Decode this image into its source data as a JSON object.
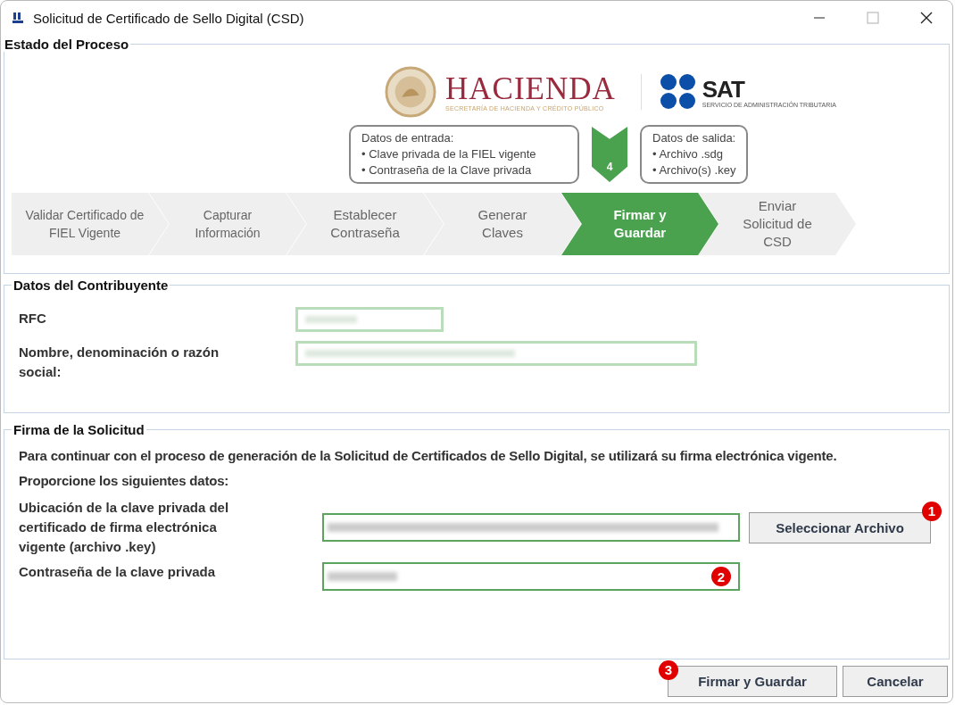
{
  "window": {
    "title": "Solicitud de Certificado de Sello Digital (CSD)"
  },
  "process": {
    "legend": "Estado del Proceso",
    "logo": {
      "brand": "HACIENDA",
      "subtitle": "SECRETARÍA DE HACIENDA Y CRÉDITO PÚBLICO",
      "agency": "SAT",
      "agency_subtitle": "SERVICIO DE ADMINISTRACIÓN TRIBUTARIA"
    },
    "input_box": {
      "title": "Datos de entrada:",
      "items": [
        "• Clave privada de la FIEL vigente",
        "• Contraseña de la Clave privada"
      ]
    },
    "step_marker": "4",
    "output_box": {
      "title": "Datos de salida:",
      "items": [
        "• Archivo .sdg",
        "• Archivo(s) .key"
      ]
    },
    "steps": [
      {
        "label": "Validar Certificado de FIEL Vigente",
        "selected": false
      },
      {
        "label": "Capturar Información",
        "selected": false
      },
      {
        "label": "Establecer Contraseña",
        "selected": false
      },
      {
        "label": "Generar Claves",
        "selected": false
      },
      {
        "label": "Firmar y Guardar",
        "selected": true
      },
      {
        "label": "Enviar Solicitud de CSD",
        "selected": false
      }
    ]
  },
  "taxpayer": {
    "legend": "Datos del Contribuyente",
    "fields": [
      {
        "label": "RFC"
      },
      {
        "label": "Nombre, denominación o razón social:"
      }
    ]
  },
  "signature": {
    "legend": "Firma de la Solicitud",
    "intro": "Para continuar con el proceso de generación de la Solicitud de Certificados de Sello Digital, se utilizará su firma electrónica vigente.",
    "prompt": "Proporcione los siguientes datos:",
    "key_file": {
      "label": "Ubicación de la clave privada del certificado de firma electrónica vigente (archivo .key)",
      "button": "Seleccionar Archivo",
      "callout": "1"
    },
    "password": {
      "label": "Contraseña de la clave privada",
      "callout": "2"
    }
  },
  "buttons": [
    {
      "label": "Firmar y Guardar",
      "callout": "3"
    },
    {
      "label": "Cancelar"
    }
  ]
}
